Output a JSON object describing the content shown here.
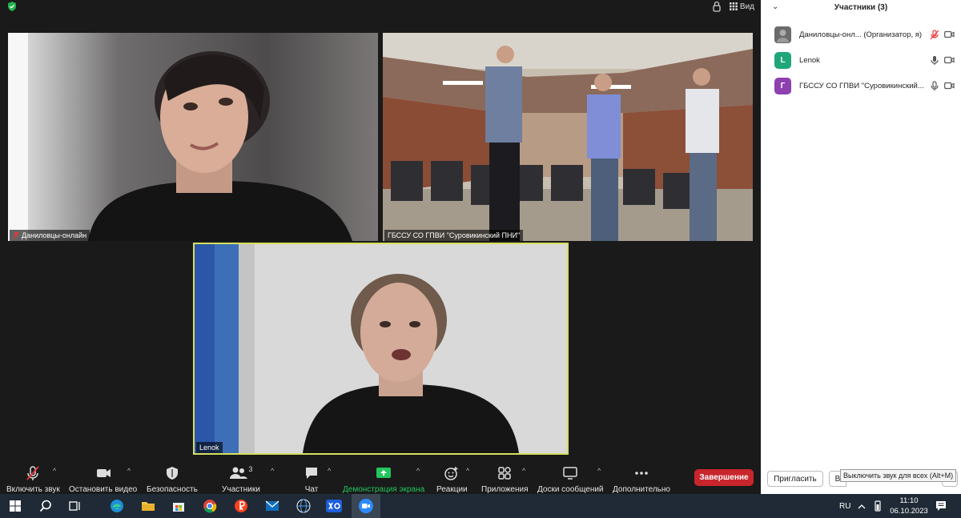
{
  "top": {
    "view_label": "Вид"
  },
  "tiles": {
    "tile1_name": "Даниловцы-онлайн",
    "tile2_name": "ГБССУ СО ГПВИ \"Суровикинский ПНИ\"",
    "tile3_name": "Lenok"
  },
  "toolbar": {
    "mute": "Включить звук",
    "video": "Остановить видео",
    "security": "Безопасность",
    "participants": "Участники",
    "participants_count": "3",
    "chat": "Чат",
    "share": "Демонстрация экрана",
    "reactions": "Реакции",
    "apps": "Приложения",
    "whiteboard": "Доски сообщений",
    "more": "Дополнительно",
    "end": "Завершение"
  },
  "panel": {
    "title": "Участники (3)",
    "participants": [
      {
        "name": "Даниловцы-онл...  (Организатор, я)",
        "avatar": "",
        "avatar_color": "#555555",
        "mic": "muted",
        "video": "on"
      },
      {
        "name": "Lenok",
        "avatar": "L",
        "avatar_color": "#1fa67a",
        "mic": "on",
        "video": "on"
      },
      {
        "name": "ГБССУ СО ГПВИ \"Суровикинский...",
        "avatar": "Г",
        "avatar_color": "#8e3fb0",
        "mic": "on",
        "video": "on"
      }
    ],
    "invite": "Пригласить",
    "second_btn": "В",
    "tooltip": "Выключить звук для всех (Alt+M)"
  },
  "taskbar": {
    "lang": "RU",
    "time": "11:10",
    "date": "06.10.2023"
  },
  "colors": {
    "share_green": "#22c55e",
    "end_red": "#c8252c",
    "active_border": "#d6e05a"
  }
}
